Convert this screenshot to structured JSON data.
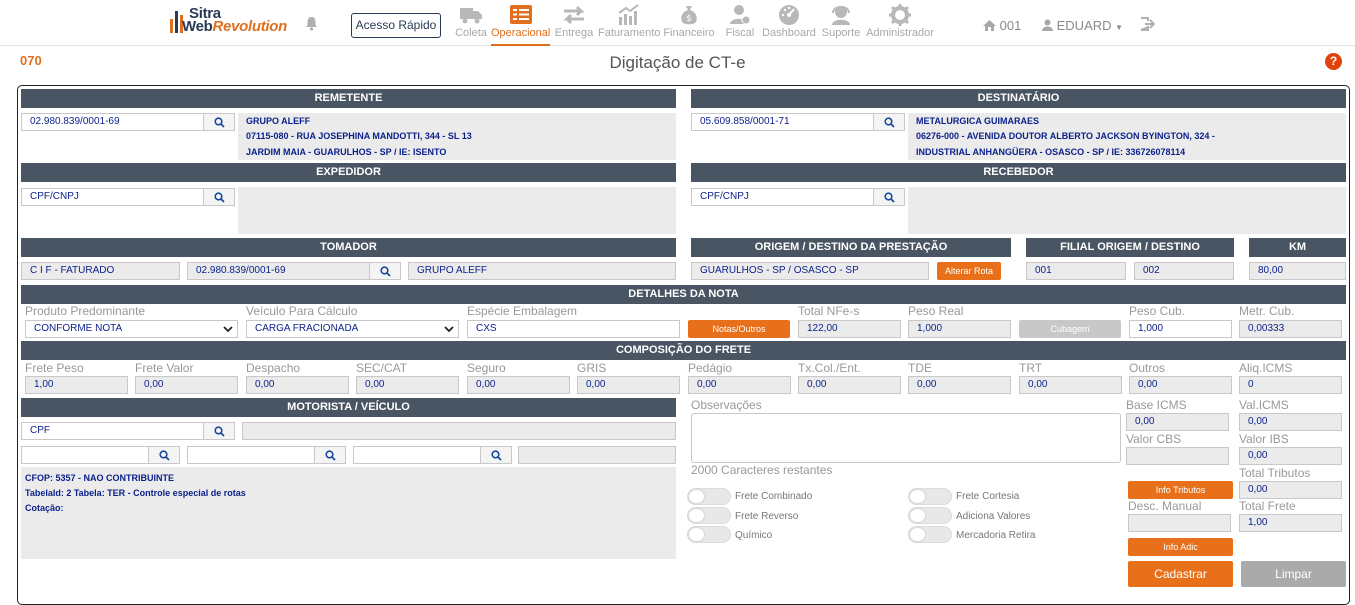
{
  "brand": {
    "line1": "Sitra",
    "line2a": "Web",
    "line2b": "Revolution"
  },
  "nav": {
    "quick_access": "Acesso Rápido",
    "items": [
      "Coleta",
      "Operacional",
      "Entrega",
      "Faturamento",
      "Financeiro",
      "Fiscal",
      "Dashboard",
      "Suporte",
      "Administrador"
    ],
    "branch": "001",
    "user": "EDUARD"
  },
  "page": {
    "code": "070",
    "title": "Digitação de CT-e",
    "help": "?"
  },
  "remetente": {
    "header": "REMETENTE",
    "cnpj": "02.980.839/0001-69",
    "name": "GRUPO ALEFF",
    "line2": "07115-080 - RUA JOSEPHINA MANDOTTI, 344 - SL 13",
    "line3": "JARDIM MAIA - GUARULHOS - SP / IE: ISENTO"
  },
  "destinatario": {
    "header": "DESTINATÁRIO",
    "cnpj": "05.609.858/0001-71",
    "name": "METALURGICA GUIMARAES",
    "line2": "06276-000 - AVENIDA DOUTOR ALBERTO JACKSON BYINGTON, 324 -",
    "line3": "INDUSTRIAL ANHANGÜERA - OSASCO - SP / IE: 336726078114"
  },
  "expedidor": {
    "header": "EXPEDIDOR",
    "placeholder": "CPF/CNPJ"
  },
  "recebedor": {
    "header": "RECEBEDOR",
    "placeholder": "CPF/CNPJ"
  },
  "tomador": {
    "header": "TOMADOR",
    "type": "C I F - FATURADO",
    "cnpj": "02.980.839/0001-69",
    "name": "GRUPO ALEFF"
  },
  "origem": {
    "header": "ORIGEM / DESTINO DA PRESTAÇÃO",
    "value": "GUARULHOS - SP  / OSASCO - SP",
    "button": "Alterar Rota"
  },
  "filial": {
    "header": "FILIAL ORIGEM / DESTINO",
    "origem": "001",
    "destino": "002"
  },
  "km": {
    "header": "KM",
    "value": "80,00"
  },
  "detalhes": {
    "header": "DETALHES DA NOTA",
    "produto_label": "Produto Predominante",
    "produto": "CONFORME NOTA",
    "veiculo_label": "Veículo Para Cálculo",
    "veiculo": "CARGA FRACIONADA",
    "especie_label": "Espécie Embalagem",
    "especie": "CXS",
    "notas_button": "Notas/Outros",
    "total_nfe_label": "Total NFe-s",
    "total_nfe": "122,00",
    "peso_real_label": "Peso Real",
    "peso_real": "1,000",
    "cubagem_button": "Cubagem",
    "peso_cub_label": "Peso Cub.",
    "peso_cub": "1,000",
    "metr_cub_label": "Metr. Cub.",
    "metr_cub": "0,00333"
  },
  "composicao": {
    "header": "COMPOSIÇÃO DO FRETE",
    "fields": [
      {
        "label": "Frete Peso",
        "value": "1,00"
      },
      {
        "label": "Frete Valor",
        "value": "0,00"
      },
      {
        "label": "Despacho",
        "value": "0,00"
      },
      {
        "label": "SEC/CAT",
        "value": "0,00"
      },
      {
        "label": "Seguro",
        "value": "0,00"
      },
      {
        "label": "GRIS",
        "value": "0,00"
      },
      {
        "label": "Pedágio",
        "value": "0,00"
      },
      {
        "label": "Tx.Col./Ent.",
        "value": "0,00"
      },
      {
        "label": "TDE",
        "value": "0,00"
      },
      {
        "label": "TRT",
        "value": "0,00"
      },
      {
        "label": "Outros",
        "value": "0,00"
      },
      {
        "label": "Aliq.ICMS",
        "value": "0"
      }
    ]
  },
  "motorista": {
    "header": "MOTORISTA / VEÍCULO",
    "cpf_placeholder": "CPF",
    "cfop": "CFOP: 5357 - NAO CONTRIBUINTE",
    "tabela": "TabelaId: 2 Tabela: TER - Controle especial de rotas",
    "cotacao": "Cotação:"
  },
  "observacoes": {
    "label": "Observações",
    "remaining": "2000 Caracteres restantes"
  },
  "toggles": {
    "frete_combinado": "Frete Combinado",
    "frete_cortesia": "Frete Cortesia",
    "frete_reverso": "Frete Reverso",
    "adiciona_valores": "Adiciona Valores",
    "quimico": "Químico",
    "mercadoria_retira": "Mercadoria Retira"
  },
  "totais": {
    "base_icms_label": "Base ICMS",
    "base_icms": "0,00",
    "val_icms_label": "Val.ICMS",
    "val_icms": "0,00",
    "valor_cbs_label": "Valor CBS",
    "valor_ibs_label": "Valor IBS",
    "valor_ibs": "0,00",
    "total_tributos_label": "Total Tributos",
    "total_tributos": "0,00",
    "info_tributos_button": "Info Tributos",
    "desc_manual_label": "Desc. Manual",
    "total_frete_label": "Total Frete",
    "total_frete": "1,00",
    "info_adic_button": "Info Adic"
  },
  "actions": {
    "cadastrar": "Cadastrar",
    "limpar": "Limpar"
  },
  "colors": {
    "accent": "#e8701a",
    "header_bar": "#4a5563",
    "value_text": "#0a1f8a"
  }
}
